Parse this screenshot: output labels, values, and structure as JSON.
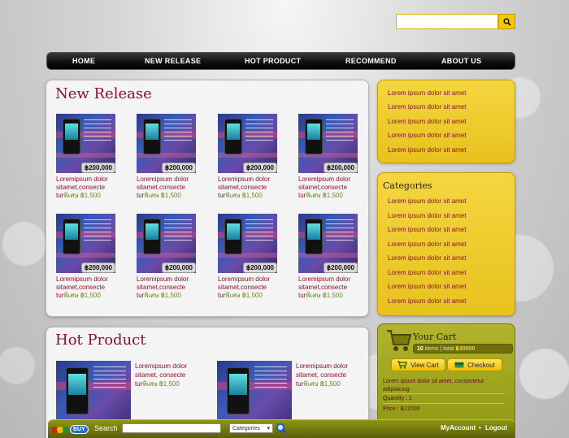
{
  "top_search": {
    "value": "",
    "placeholder": ""
  },
  "nav": {
    "items": [
      "HOME",
      "NEW RELEASE",
      "HOT PRODUCT",
      "RECOMMEND",
      "ABOUT US"
    ]
  },
  "new_release": {
    "title": "New Release",
    "products": [
      {
        "price": "฿200,000",
        "desc": "Loremipsum dolor sitamet,consecte",
        "sale_prefix": "tur",
        "sale": "พิเศษ ฿1,500"
      },
      {
        "price": "฿200,000",
        "desc": "Loremipsum dolor sitamet,consecte",
        "sale_prefix": "tur",
        "sale": "พิเศษ ฿1,500"
      },
      {
        "price": "฿200,000",
        "desc": "Loremipsum dolor sitamet,consecte",
        "sale_prefix": "tur",
        "sale": "พิเศษ ฿1,500"
      },
      {
        "price": "฿200,000",
        "desc": "Loremipsum dolor sitamet,consecte",
        "sale_prefix": "tur",
        "sale": "พิเศษ ฿1,500"
      },
      {
        "price": "฿200,000",
        "desc": "Loremipsum dolor sitamet,consecte",
        "sale_prefix": "tur",
        "sale": "พิเศษ ฿1,500"
      },
      {
        "price": "฿200,000",
        "desc": "Loremipsum dolor sitamet,consecte",
        "sale_prefix": "tur",
        "sale": "พิเศษ ฿1,500"
      },
      {
        "price": "฿200,000",
        "desc": "Loremipsum dolor sitamet,consecte",
        "sale_prefix": "tur",
        "sale": "พิเศษ ฿1,500"
      },
      {
        "price": "฿200,000",
        "desc": "Loremipsum dolor sitamet,consecte",
        "sale_prefix": "tur",
        "sale": "พิเศษ ฿1,500"
      }
    ]
  },
  "hot_product": {
    "title": "Hot Product",
    "items": [
      {
        "desc": "Loremipsum dolor sitamet, consecte",
        "sale_prefix": "tur",
        "sale": "พิเศษ ฿1,500"
      },
      {
        "desc": "Loremipsum dolor sitamet, consecte",
        "sale_prefix": "tur",
        "sale": "พิเศษ ฿1,500"
      }
    ]
  },
  "side_links": [
    "Lorem ipsum dolor sit amet",
    "Lorem ipsum dolor sit amet",
    "Lorem ipsum dolor sit amet",
    "Lorem ipsum dolor sit amet",
    "Lorem ipsum dolor sit amet"
  ],
  "categories": {
    "title": "Categories",
    "items": [
      "Lorem ipsum dolor sit amet",
      "Lorem ipsum dolor sit amet",
      "Lorem ipsum dolor sit amet",
      "Lorem ipsum dolor sit amet",
      "Lorem ipsum dolor sit amet",
      "Lorem ipsum dolor sit amet",
      "Lorem ipsum dolor sit amet",
      "Lorem ipsum dolor sit amet"
    ]
  },
  "cart": {
    "title": "Your Cart",
    "items_count": "10",
    "items_label": "items",
    "total_label": "total",
    "total": "฿30000",
    "view_cart": "View Cart",
    "checkout": "Checkout",
    "item_desc": "Lorem ipsum dolor sit amet, consectetur adipisicing",
    "quantity": "Quantity : 1",
    "price": "Price : ฿12000"
  },
  "bottom_bar": {
    "logo_text": "BUY",
    "search_label": "Search",
    "search_value": "",
    "category_select": "Categories",
    "my_account": "MyAccount",
    "logout": "Logout"
  },
  "colors": {
    "accent": "#8a1230",
    "yellow": "#f2c800",
    "olive": "#8e9612"
  }
}
